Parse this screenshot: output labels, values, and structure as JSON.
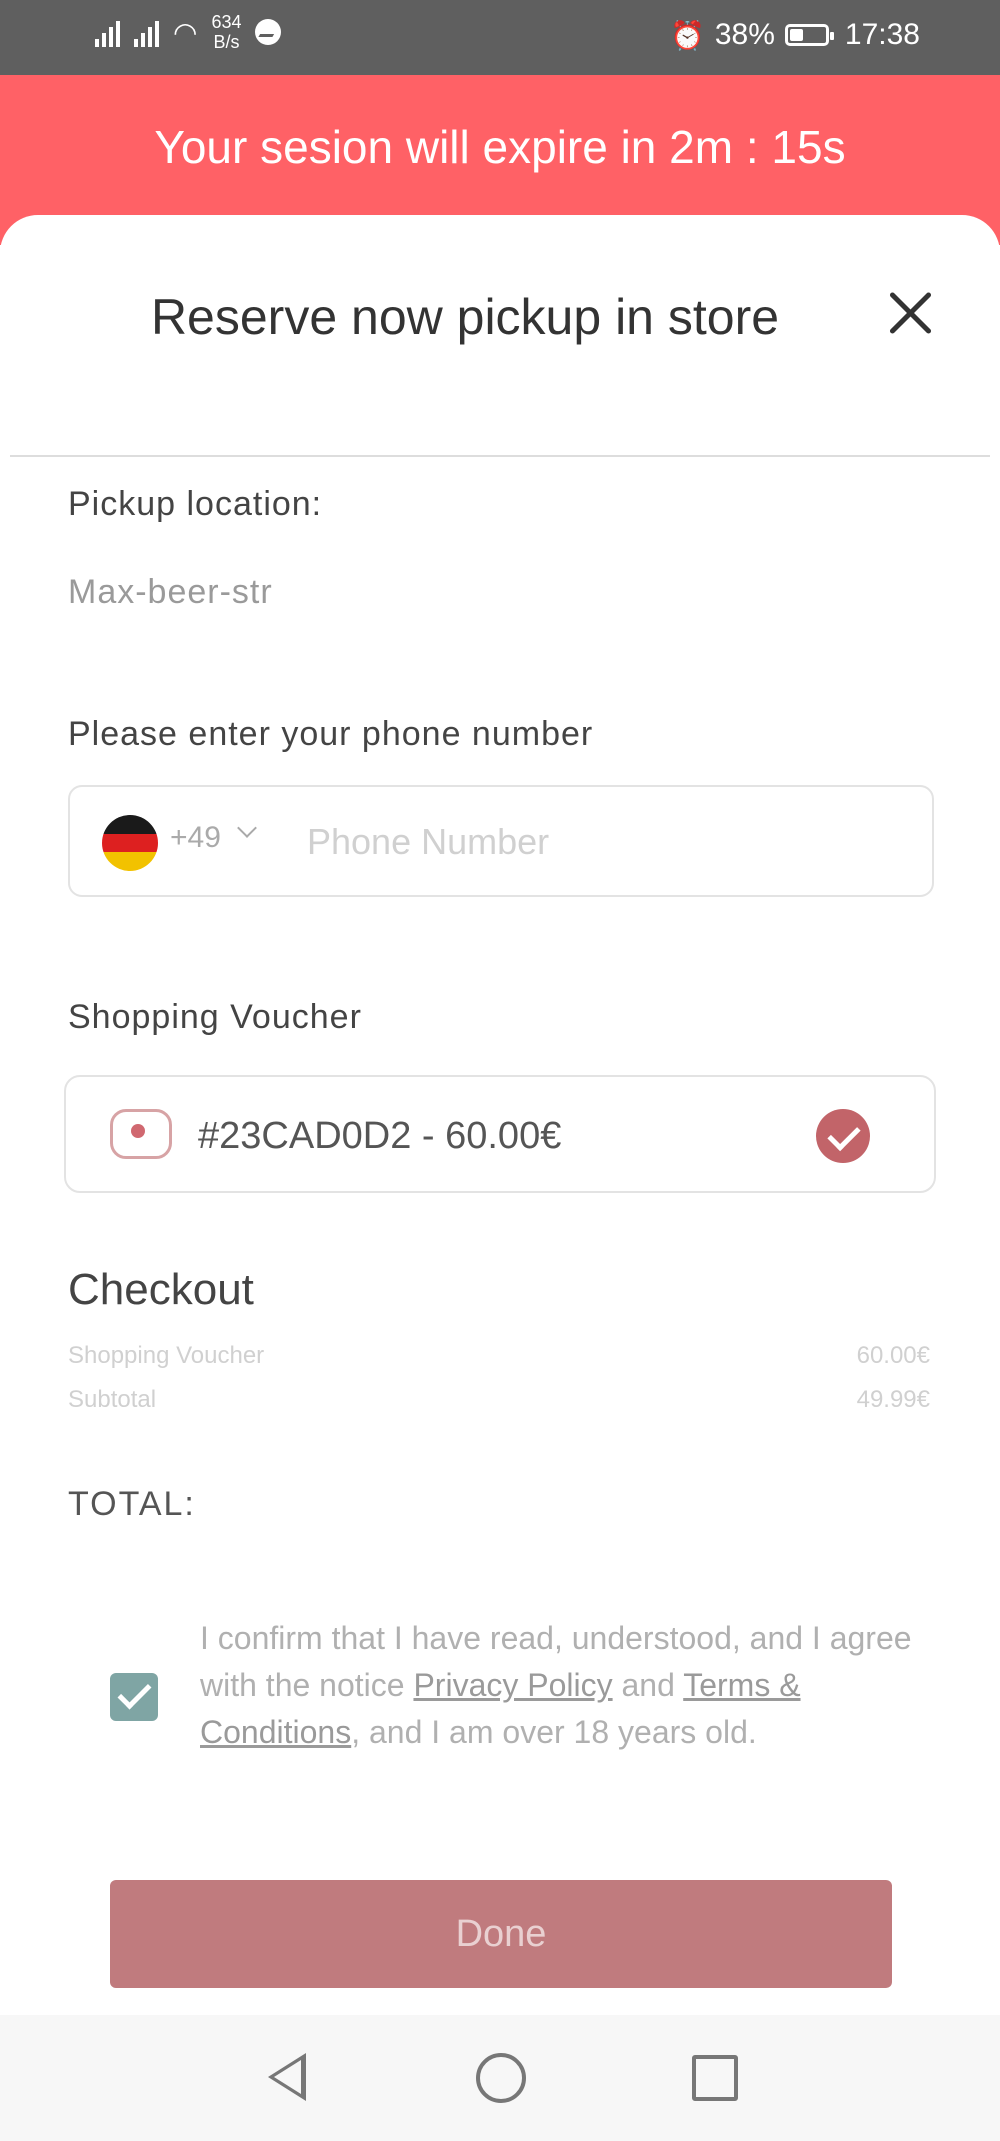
{
  "status_bar": {
    "net_speed_value": "634",
    "net_speed_unit": "B/s",
    "battery": "38%",
    "battery_level": 0.38,
    "time": "17:38"
  },
  "banner": {
    "text": "Your sesion will expire in 2m : 15s"
  },
  "sheet": {
    "title": "Reserve now pickup in store",
    "close_icon": "close-icon"
  },
  "pickup": {
    "label": "Pickup location:",
    "value": "Max-beer-str"
  },
  "phone": {
    "label": "Please enter your phone number",
    "dial_code": "+49",
    "placeholder": "Phone Number",
    "value": "",
    "flag_colors": [
      "#1a1a1a",
      "#dd2020",
      "#f2c200"
    ]
  },
  "voucher": {
    "label": "Shopping Voucher",
    "code_amount": "#23CAD0D2 - 60.00€",
    "selected": true
  },
  "checkout": {
    "title": "Checkout",
    "rows": [
      {
        "label": "Shopping Voucher",
        "amount": "60.00€"
      },
      {
        "label": "Subtotal",
        "amount": "49.99€"
      }
    ],
    "total_label": "TOTAL:"
  },
  "consent": {
    "checked": true,
    "text_before": "I confirm that I have read, understood, and I agree with the notice ",
    "privacy_link": "Privacy Policy",
    "text_middle": " and ",
    "terms_link": "Terms & Conditions",
    "text_after": ", and I am over 18 years old."
  },
  "done_button": {
    "label": "Done"
  },
  "colors": {
    "banner": "#ff6166",
    "accent": "#c26469",
    "button": "#c07b7e",
    "checkbox": "#7fa5a4"
  }
}
